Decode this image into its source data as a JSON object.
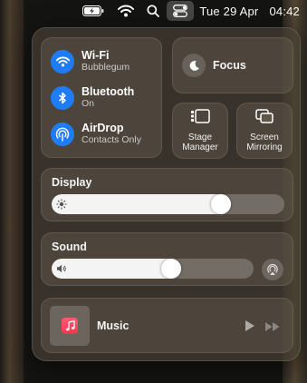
{
  "menubar": {
    "date": "Tue 29 Apr",
    "time": "04:42",
    "icons": [
      "battery-charging-icon",
      "wifi-icon",
      "search-icon",
      "control-centre-icon"
    ]
  },
  "network": {
    "wifi": {
      "title": "Wi‑Fi",
      "subtitle": "Bubblegum"
    },
    "bluetooth": {
      "title": "Bluetooth",
      "subtitle": "On"
    },
    "airdrop": {
      "title": "AirDrop",
      "subtitle": "Contacts Only"
    }
  },
  "focus": {
    "label": "Focus"
  },
  "stage_manager": {
    "label_line1": "Stage",
    "label_line2": "Manager"
  },
  "screen_mirroring": {
    "label_line1": "Screen",
    "label_line2": "Mirroring"
  },
  "display": {
    "label": "Display",
    "level": 0.75
  },
  "sound": {
    "label": "Sound",
    "level": 0.6
  },
  "music": {
    "label": "Music"
  },
  "colors": {
    "accent": "#1e7df6",
    "music_icon": "#f5364f"
  }
}
